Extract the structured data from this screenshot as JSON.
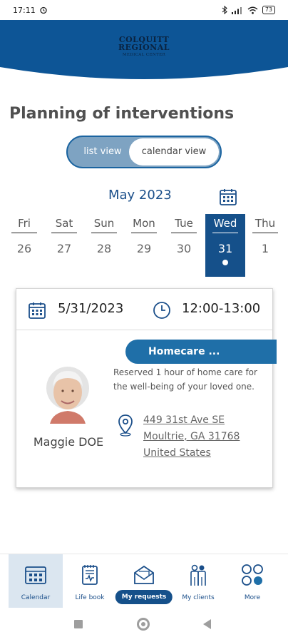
{
  "status": {
    "time": "17:11",
    "battery": "73"
  },
  "header": {
    "logo_line1": "COLQUITT",
    "logo_line2": "REGIONAL",
    "logo_line3": "MEDICAL CENTER",
    "brand_color": "#0d5596"
  },
  "page": {
    "title": "Planning of interventions"
  },
  "view_toggle": {
    "options": [
      "list view",
      "calendar view"
    ],
    "selected": "calendar view"
  },
  "calendar": {
    "month": "May 2023",
    "days": [
      {
        "name": "Fri",
        "num": "26"
      },
      {
        "name": "Sat",
        "num": "27"
      },
      {
        "name": "Sun",
        "num": "28"
      },
      {
        "name": "Mon",
        "num": "29"
      },
      {
        "name": "Tue",
        "num": "30"
      },
      {
        "name": "Wed",
        "num": "31"
      },
      {
        "name": "Thu",
        "num": "1"
      }
    ],
    "selected_day": "Wed 31",
    "selected_color": "#15508a"
  },
  "appointment": {
    "date": "5/31/2023",
    "time": "12:00-13:00",
    "service": "Homecare ...",
    "description": "Reserved 1 hour of home care for the well-being of your loved one.",
    "client_name": "Maggie DOE",
    "address_line1": "449 31st Ave SE",
    "address_line2": "Moultrie, GA 31768",
    "address_line3": "United States"
  },
  "bottom_nav": {
    "items": [
      {
        "label": "Calendar",
        "icon": "calendar-icon"
      },
      {
        "label": "Life book",
        "icon": "book-icon"
      },
      {
        "label": "My requests",
        "icon": "envelope-icon"
      },
      {
        "label": "My clients",
        "icon": "people-icon"
      },
      {
        "label": "More",
        "icon": "grid-icon"
      }
    ],
    "active": "Calendar"
  }
}
